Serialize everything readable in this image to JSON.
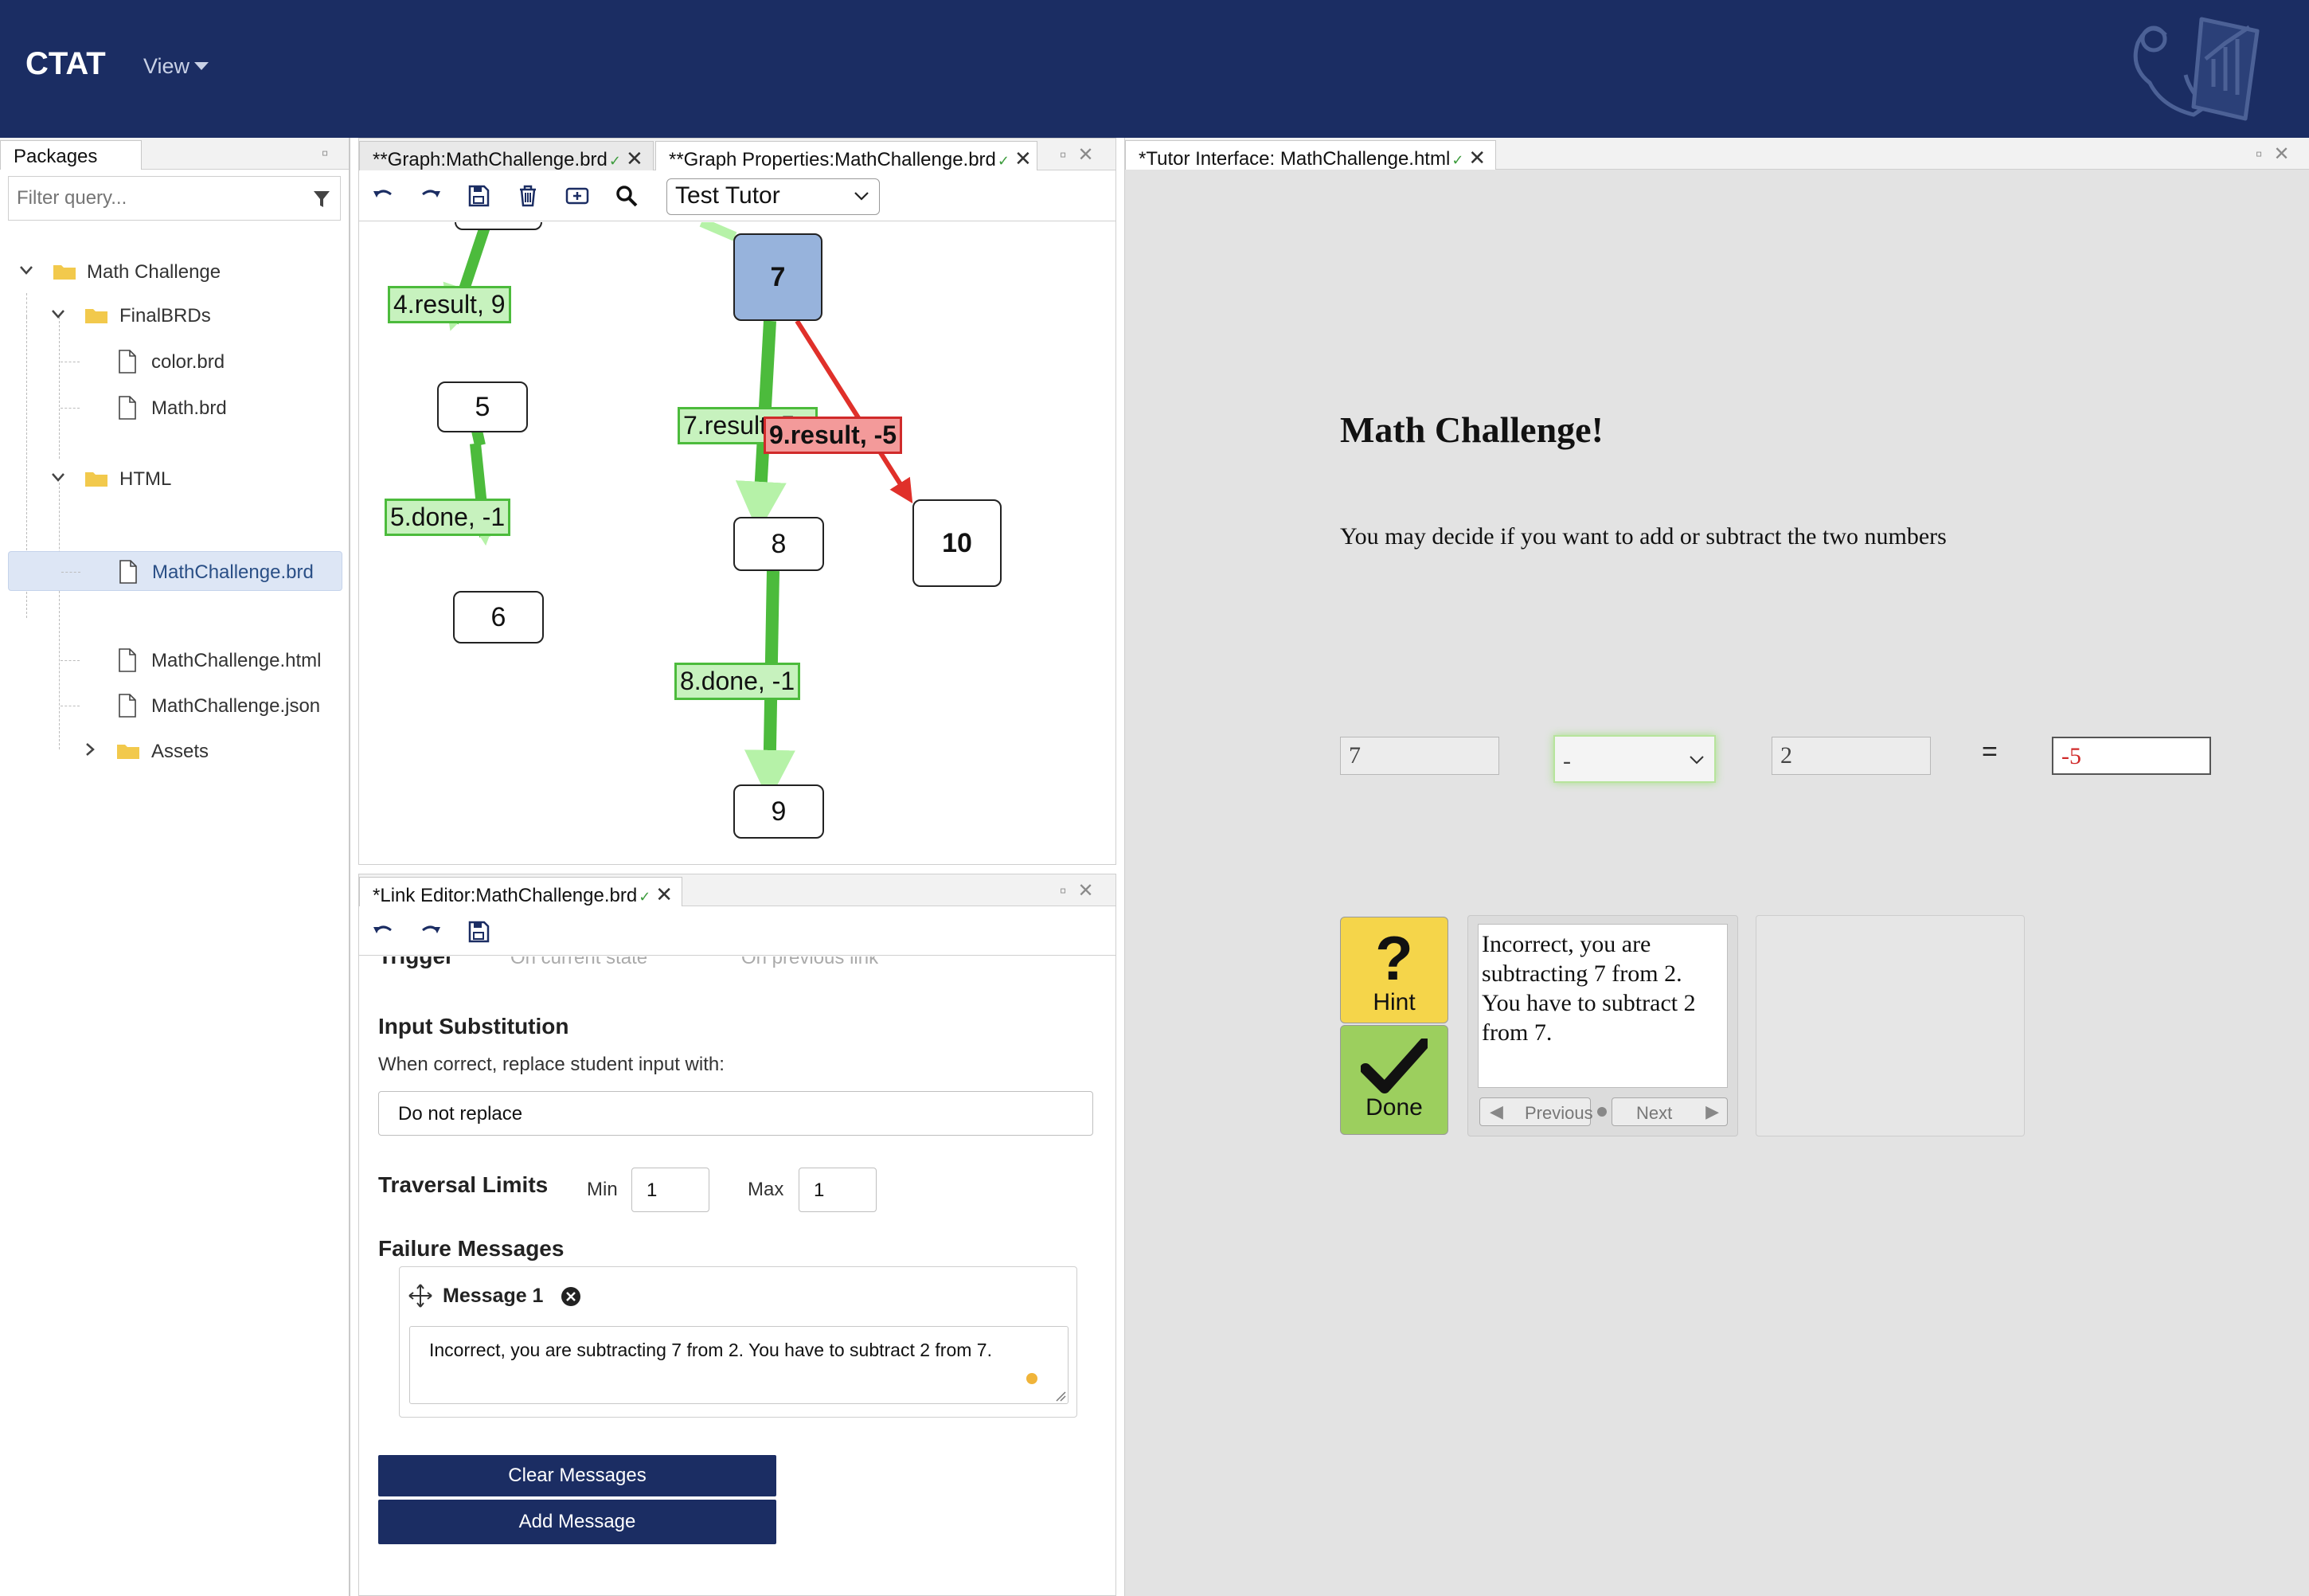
{
  "header": {
    "app_title": "CTAT",
    "view_menu": "View"
  },
  "packages": {
    "tab_label": "Packages",
    "filter_placeholder": "Filter query...",
    "tree": [
      {
        "label": "Math Challenge",
        "type": "folder"
      },
      {
        "label": "FinalBRDs",
        "type": "folder"
      },
      {
        "label": "color.brd",
        "type": "file"
      },
      {
        "label": "Math.brd",
        "type": "file"
      },
      {
        "label": "MathChallenge.brd",
        "type": "file",
        "selected": true
      },
      {
        "label": "HTML",
        "type": "folder"
      },
      {
        "label": "MathChallenge.html",
        "type": "file"
      },
      {
        "label": "MathChallenge.json",
        "type": "file"
      },
      {
        "label": "Assets",
        "type": "folder"
      }
    ]
  },
  "graph": {
    "tabs": [
      {
        "label": "**Graph:MathChallenge.brd"
      },
      {
        "label": "**Graph Properties:MathChallenge.brd"
      }
    ],
    "tutor_mode": "Test Tutor",
    "nodes": {
      "n5": "5",
      "n6": "6",
      "n7": "7",
      "n8": "8",
      "n9": "9",
      "n10": "10"
    },
    "edges": {
      "e4": "4.result, 9",
      "e5": "5.done, -1",
      "e7": "7.result, 5",
      "e8": "8.done, -1",
      "e9": "9.result, -5"
    }
  },
  "link_editor": {
    "tab_label": "*Link Editor:MathChallenge.brd",
    "trigger_label": "Trigger",
    "trigger_opt1": "On current state",
    "trigger_opt2": "On previous link",
    "input_sub_heading": "Input Substitution",
    "input_sub_desc": "When correct, replace student input with:",
    "input_sub_value": "Do not replace",
    "traversal_heading": "Traversal Limits",
    "min_label": "Min",
    "min_value": "1",
    "max_label": "Max",
    "max_value": "1",
    "failure_heading": "Failure Messages",
    "message_title": "Message 1",
    "message_text": "Incorrect, you are subtracting 7 from 2. You have to subtract 2 from 7.",
    "clear_button": "Clear Messages",
    "add_button": "Add Message"
  },
  "tutor": {
    "tab_label": "*Tutor Interface: MathChallenge.html",
    "title": "Math Challenge!",
    "instructions": "You may decide if you want to add or subtract the two numbers",
    "operand1": "7",
    "operator": "-",
    "operand2": "2",
    "equals": "=",
    "result": "-5",
    "hint_label": "Hint",
    "done_label": "Done",
    "feedback": "Incorrect, you are subtracting 7 from 2. You have to subtract 2 from 7.",
    "prev_label": "Previous",
    "next_label": "Next"
  },
  "colors": {
    "header_bg": "#1b2d63",
    "correct_link": "#4cbb3c",
    "wrong_link": "#e0302a",
    "hint_yellow": "#f5d54a",
    "done_green": "#9ccf5e",
    "error_red": "#d02a2a"
  }
}
